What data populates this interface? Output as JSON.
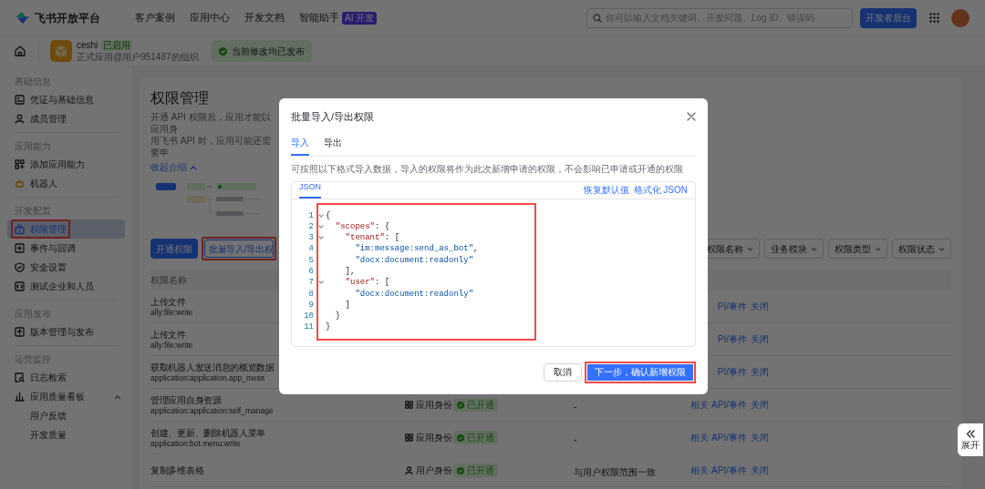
{
  "header": {
    "logo_text": "飞书开放平台",
    "nav": [
      {
        "label": "客户案例"
      },
      {
        "label": "应用中心"
      },
      {
        "label": "开发文档"
      },
      {
        "label": "智能助手",
        "badge": "AI 开发"
      }
    ],
    "search": {
      "placeholder": "你可以输入文档关键词、开发问题、Log ID、错误码"
    },
    "console_button": "开发者后台"
  },
  "app_bar": {
    "app_name": "ceshi",
    "app_status": "已启用",
    "app_subtitle": "正式应用@用户951487的组织",
    "notice": "当前修改均已发布"
  },
  "sidebar": {
    "sections": [
      {
        "title": "基础信息",
        "items": [
          {
            "label": "凭证与基础信息",
            "selected": false
          },
          {
            "label": "成员管理",
            "selected": false
          }
        ]
      },
      {
        "title": "应用能力",
        "items": [
          {
            "label": "添加应用能力",
            "selected": false
          },
          {
            "label": "机器人",
            "selected": false
          }
        ]
      },
      {
        "title": "开发配置",
        "items": [
          {
            "label": "权限管理",
            "selected": true,
            "highlighted": true
          },
          {
            "label": "事件与回调",
            "selected": false
          },
          {
            "label": "安全设置",
            "selected": false
          },
          {
            "label": "测试企业和人员",
            "selected": false
          }
        ]
      },
      {
        "title": "应用发布",
        "items": [
          {
            "label": "版本管理与发布",
            "selected": false
          }
        ]
      },
      {
        "title": "运营监控",
        "items": [
          {
            "label": "日志检索",
            "selected": false
          },
          {
            "label": "应用质量看板",
            "selected": false,
            "expanded": true,
            "children": [
              {
                "label": "用户反馈",
                "selected": false
              },
              {
                "label": "开发质量",
                "selected": false
              }
            ]
          }
        ]
      }
    ]
  },
  "page": {
    "title": "权限管理",
    "intro_lines": [
      "开通 API 权限后，应用才能以应用身",
      "用飞书 API 时，应用可能还需要申"
    ],
    "collapse_link": "收起介绍",
    "buttons": [
      {
        "label": "开通权限",
        "kind": "primary",
        "highlighted": false
      },
      {
        "label": "批量导入/导出权",
        "kind": "outline",
        "highlighted": true
      }
    ],
    "filters": [
      "权限名称",
      "业务模块",
      "权限类型",
      "权限状态"
    ],
    "table": {
      "columns": [
        "权限名称"
      ],
      "rows": [
        {
          "name": "上传文件",
          "scope": "ally:file:write",
          "actions": [
            "PI/事件",
            "关闭"
          ]
        },
        {
          "name": "上传文件",
          "scope": "ally:file:write",
          "actions": [
            "PI/事件",
            "关闭"
          ]
        },
        {
          "name": "获取机器人发送消息的概览数据",
          "scope": "application:application.app_mess",
          "actions": [
            "PI/事件",
            "关闭"
          ]
        },
        {
          "name": "管理应用自身资源",
          "scope": "application:application:self_manage",
          "identity": "应用身份",
          "kind": "app",
          "status": "已开通",
          "range": "-",
          "actions": [
            "相关 API/事件",
            "关闭"
          ]
        },
        {
          "name": "创建、更新、删除机器人菜单",
          "scope": "application:bot.menu:write",
          "identity": "应用身份",
          "kind": "app",
          "status": "已开通",
          "range": "-",
          "actions": [
            "相关 API/事件",
            "关闭"
          ]
        },
        {
          "name": "复制多维表格",
          "identity": "用户身份",
          "kind": "user",
          "status": "已开通",
          "range": "与用户权限范围一致",
          "actions": [
            "相关 API/事件",
            "关闭"
          ]
        }
      ]
    }
  },
  "modal": {
    "title": "批量导入/导出权限",
    "tabs": [
      {
        "label": "导入",
        "selected": true
      },
      {
        "label": "导出",
        "selected": false
      }
    ],
    "description": "可按照以下格式导入数据，导入的权限将作为此次新增申请的权限，不会影响已申请或开通的权限",
    "editor": {
      "tabs": [
        {
          "label": "JSON",
          "selected": true
        }
      ],
      "links": [
        "恢复默认值",
        "格式化 JSON"
      ],
      "highlighted": true,
      "lines": [
        {
          "number": "1",
          "text": "{",
          "foldable": true
        },
        {
          "number": "2",
          "text": "  \"scopes\": {",
          "foldable": true
        },
        {
          "number": "3",
          "text": "    \"tenant\": [",
          "foldable": true
        },
        {
          "number": "4",
          "text": "      \"im:message:send_as_bot\",",
          "foldable": false
        },
        {
          "number": "5",
          "text": "      \"docx:document:readonly\"",
          "foldable": false
        },
        {
          "number": "6",
          "text": "    ],",
          "foldable": false
        },
        {
          "number": "7",
          "text": "    \"user\": [",
          "foldable": true
        },
        {
          "number": "8",
          "text": "      \"docx:document:readonly\"",
          "foldable": false
        },
        {
          "number": "9",
          "text": "    ]",
          "foldable": false
        },
        {
          "number": "10",
          "text": "  }",
          "foldable": false
        },
        {
          "number": "11",
          "text": "}",
          "foldable": false
        }
      ]
    },
    "buttons": [
      {
        "label": "取消",
        "kind": "secondary",
        "highlighted": false
      },
      {
        "label": "下一步，确认新增权限",
        "kind": "primary",
        "highlighted": true
      }
    ]
  },
  "side_toggle": {
    "label": "展开"
  }
}
